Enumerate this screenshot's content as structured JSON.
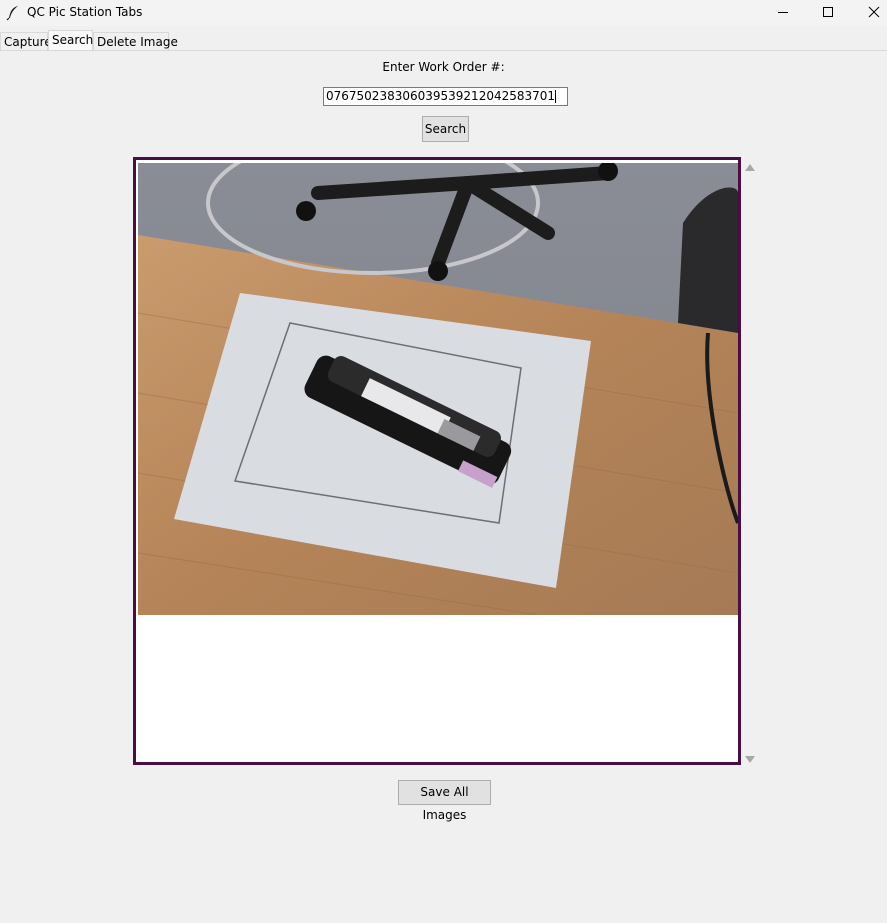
{
  "window": {
    "title": "QC Pic Station Tabs",
    "app_icon": "feather-icon",
    "controls": [
      "minimize-icon",
      "maximize-icon",
      "close-icon"
    ]
  },
  "tabs": [
    {
      "label": "Capture",
      "active": false
    },
    {
      "label": "Search",
      "active": true
    },
    {
      "label": "Delete Image",
      "active": false
    }
  ],
  "search": {
    "label": "Enter Work Order #:",
    "input_value": "076750238306039539212042583701",
    "button_label": "Search"
  },
  "results": {
    "image_alt": "stapler on paper on wooden table",
    "frame_color": "#4a0f42"
  },
  "footer": {
    "save_button_label": "Save All Images"
  }
}
